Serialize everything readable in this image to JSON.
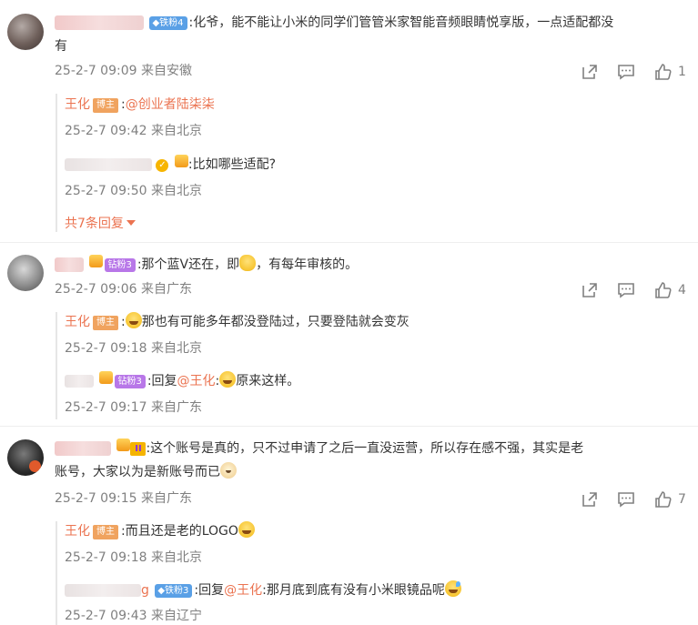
{
  "comments": [
    {
      "badge": "铁粉4",
      "text": ":化爷，能不能让小米的同学们管管米家智能音频眼睛悦享版，一点适配都没",
      "text2": "有",
      "meta": "25-2-7 09:09 来自安徽",
      "like_count": "1",
      "replies": [
        {
          "name": "王化",
          "role": "博主",
          "text_prefix": ":",
          "mention": "@创业者陆柒柒",
          "text": "",
          "meta": "25-2-7 09:42 来自北京"
        },
        {
          "text": ":比如哪些适配?",
          "meta": "25-2-7 09:50 来自北京"
        }
      ],
      "more_label": "共7条回复"
    },
    {
      "badge": "钻粉3",
      "text_a": ":那个蓝V还在，即",
      "text_b": "，有每年审核的。",
      "meta": "25-2-7 09:06 来自广东",
      "like_count": "4",
      "replies": [
        {
          "name": "王化",
          "role": "博主",
          "text": "那也有可能多年都没登陆过，只要登陆就会变灰",
          "meta": "25-2-7 09:18 来自北京"
        },
        {
          "badge": "钻粉3",
          "text_a": ":回复",
          "mention": "@王化",
          "text_b": ":",
          "text_c": "原来这样。",
          "meta": "25-2-7 09:17 来自广东"
        }
      ]
    },
    {
      "vip": "II",
      "text": ":这个账号是真的，只不过申请了之后一直没运营，所以存在感不强，其实是老",
      "text2": "账号，大家以为是新账号而已",
      "meta": "25-2-7 09:15 来自广东",
      "like_count": "7",
      "replies": [
        {
          "name": "王化",
          "role": "博主",
          "text": ":而且还是老的LOGO",
          "meta": "25-2-7 09:18 来自北京"
        },
        {
          "blur_tail": "g",
          "badge": "铁粉3",
          "text_a": ":回复",
          "mention": "@王化",
          "text_b": ":那月底到底有没有小米眼镜品呢",
          "meta": "25-2-7 09:43 来自辽宁"
        }
      ]
    }
  ]
}
